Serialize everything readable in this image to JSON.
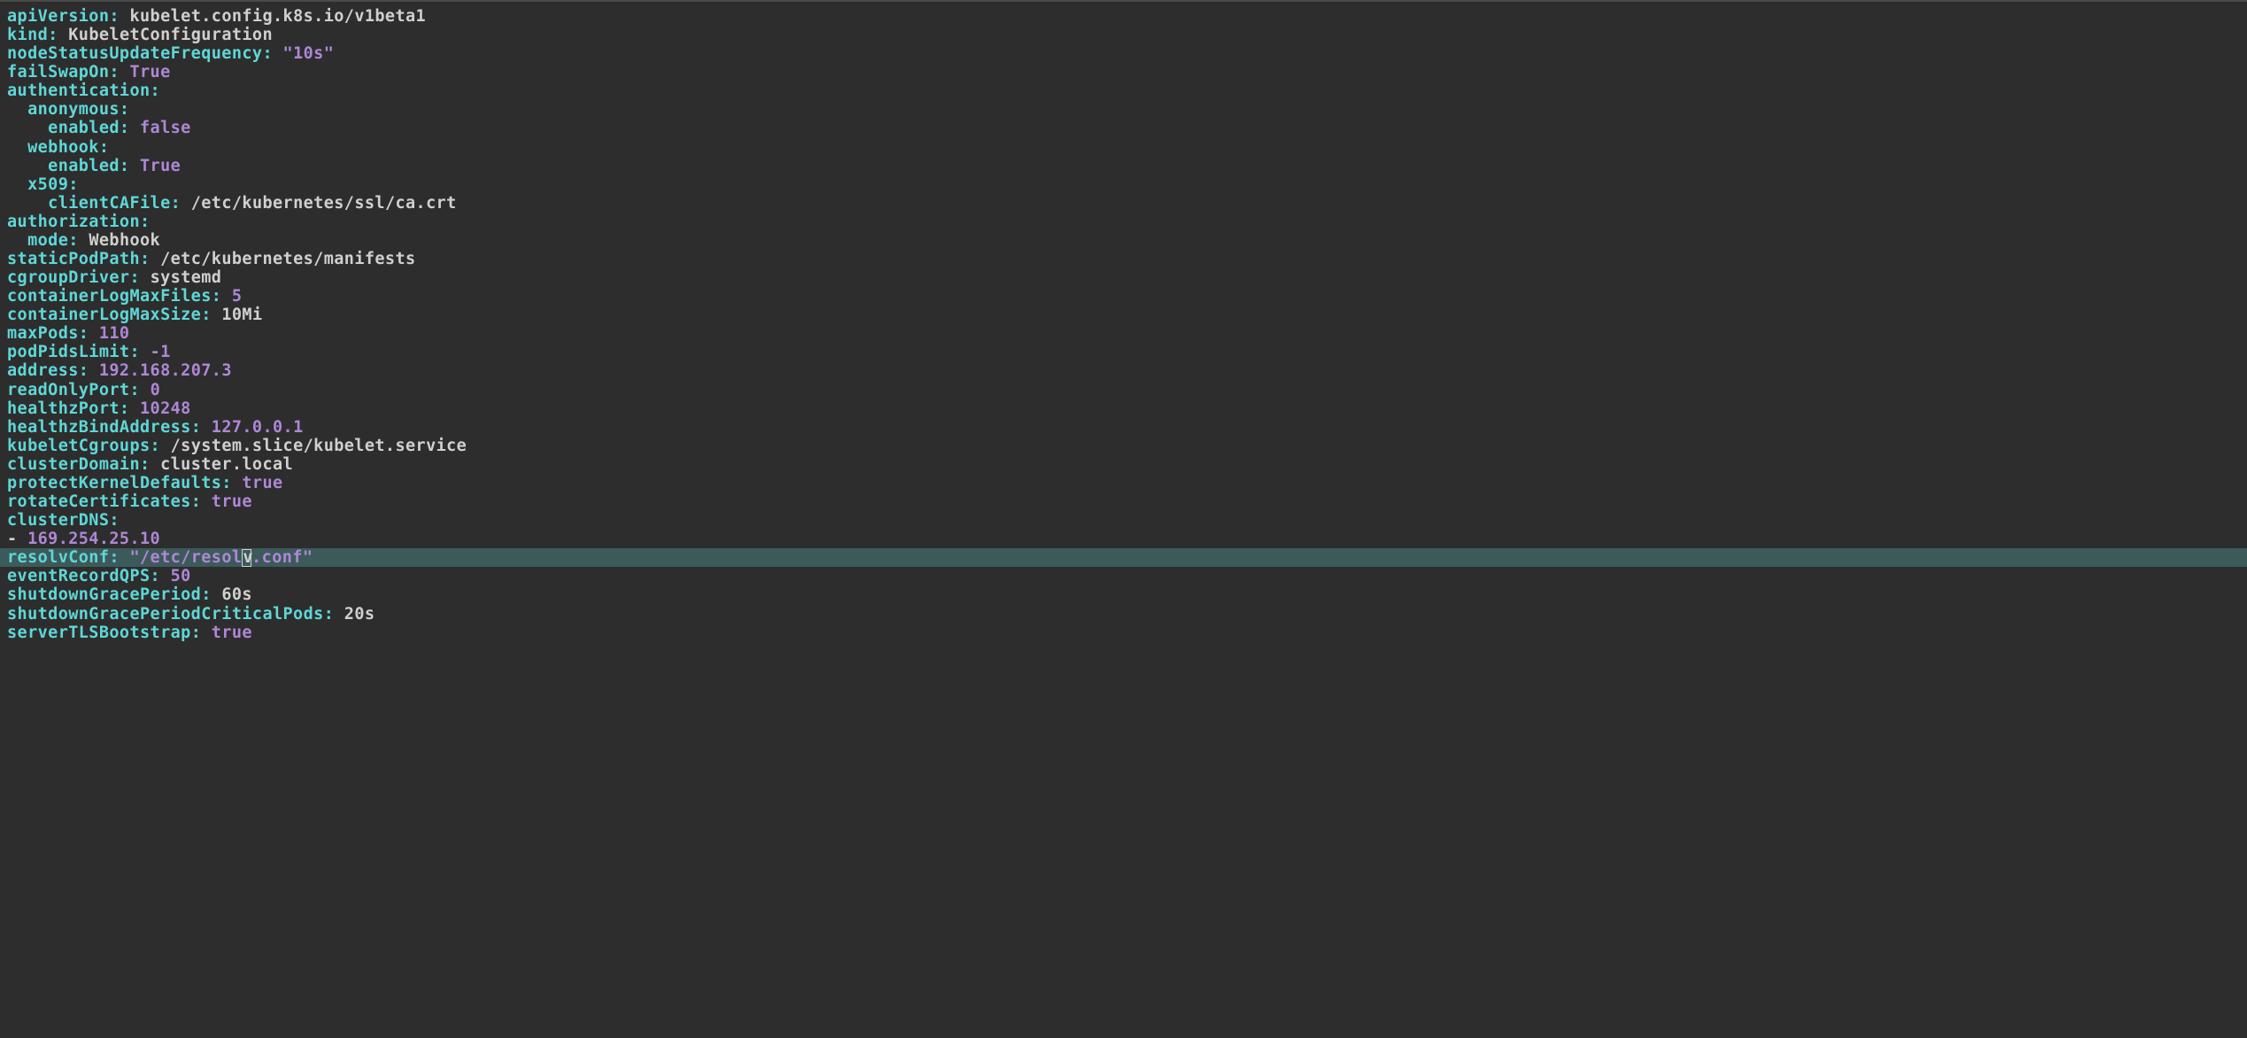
{
  "lines": [
    {
      "indent": 0,
      "type": "kv",
      "key": "apiVersion",
      "value": "kubelet.config.k8s.io/v1beta1",
      "valueKind": "plain"
    },
    {
      "indent": 0,
      "type": "kv",
      "key": "kind",
      "value": "KubeletConfiguration",
      "valueKind": "plain"
    },
    {
      "indent": 0,
      "type": "kv",
      "key": "nodeStatusUpdateFrequency",
      "value": "\"10s\"",
      "valueKind": "string"
    },
    {
      "indent": 0,
      "type": "kv",
      "key": "failSwapOn",
      "value": "True",
      "valueKind": "bool"
    },
    {
      "indent": 0,
      "type": "k",
      "key": "authentication"
    },
    {
      "indent": 1,
      "type": "k",
      "key": "anonymous"
    },
    {
      "indent": 2,
      "type": "kv",
      "key": "enabled",
      "value": "false",
      "valueKind": "bool"
    },
    {
      "indent": 1,
      "type": "k",
      "key": "webhook"
    },
    {
      "indent": 2,
      "type": "kv",
      "key": "enabled",
      "value": "True",
      "valueKind": "bool"
    },
    {
      "indent": 1,
      "type": "k",
      "key": "x509"
    },
    {
      "indent": 2,
      "type": "kv",
      "key": "clientCAFile",
      "value": "/etc/kubernetes/ssl/ca.crt",
      "valueKind": "plain"
    },
    {
      "indent": 0,
      "type": "k",
      "key": "authorization"
    },
    {
      "indent": 1,
      "type": "kv",
      "key": "mode",
      "value": "Webhook",
      "valueKind": "plain"
    },
    {
      "indent": 0,
      "type": "kv",
      "key": "staticPodPath",
      "value": "/etc/kubernetes/manifests",
      "valueKind": "plain"
    },
    {
      "indent": 0,
      "type": "kv",
      "key": "cgroupDriver",
      "value": "systemd",
      "valueKind": "plain"
    },
    {
      "indent": 0,
      "type": "kv",
      "key": "containerLogMaxFiles",
      "value": "5",
      "valueKind": "number"
    },
    {
      "indent": 0,
      "type": "kv",
      "key": "containerLogMaxSize",
      "value": "10Mi",
      "valueKind": "plain"
    },
    {
      "indent": 0,
      "type": "kv",
      "key": "maxPods",
      "value": "110",
      "valueKind": "number"
    },
    {
      "indent": 0,
      "type": "kv",
      "key": "podPidsLimit",
      "value": "-1",
      "valueKind": "number"
    },
    {
      "indent": 0,
      "type": "kv",
      "key": "address",
      "value": "192.168.207.3",
      "valueKind": "number"
    },
    {
      "indent": 0,
      "type": "kv",
      "key": "readOnlyPort",
      "value": "0",
      "valueKind": "number"
    },
    {
      "indent": 0,
      "type": "kv",
      "key": "healthzPort",
      "value": "10248",
      "valueKind": "number"
    },
    {
      "indent": 0,
      "type": "kv",
      "key": "healthzBindAddress",
      "value": "127.0.0.1",
      "valueKind": "number"
    },
    {
      "indent": 0,
      "type": "kv",
      "key": "kubeletCgroups",
      "value": "/system.slice/kubelet.service",
      "valueKind": "plain"
    },
    {
      "indent": 0,
      "type": "kv",
      "key": "clusterDomain",
      "value": "cluster.local",
      "valueKind": "plain"
    },
    {
      "indent": 0,
      "type": "kv",
      "key": "protectKernelDefaults",
      "value": "true",
      "valueKind": "bool"
    },
    {
      "indent": 0,
      "type": "kv",
      "key": "rotateCertificates",
      "value": "true",
      "valueKind": "bool"
    },
    {
      "indent": 0,
      "type": "k",
      "key": "clusterDNS"
    },
    {
      "indent": 0,
      "type": "li",
      "value": "169.254.25.10",
      "valueKind": "number"
    },
    {
      "indent": 0,
      "type": "kv",
      "key": "resolvConf",
      "value": "\"/etc/resolv.conf\"",
      "valueKind": "string",
      "highlighted": true,
      "cursorAt": 23
    },
    {
      "indent": 0,
      "type": "kv",
      "key": "eventRecordQPS",
      "value": "50",
      "valueKind": "number"
    },
    {
      "indent": 0,
      "type": "kv",
      "key": "shutdownGracePeriod",
      "value": "60s",
      "valueKind": "plain"
    },
    {
      "indent": 0,
      "type": "kv",
      "key": "shutdownGracePeriodCriticalPods",
      "value": "20s",
      "valueKind": "plain"
    },
    {
      "indent": 0,
      "type": "kv",
      "key": "serverTLSBootstrap",
      "value": "true",
      "valueKind": "bool"
    }
  ]
}
